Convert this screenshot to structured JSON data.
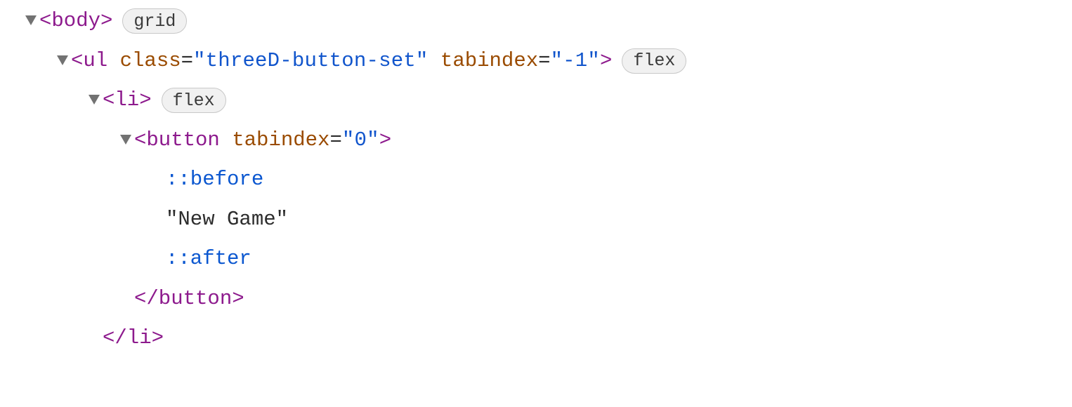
{
  "tree": {
    "body": {
      "tag_open": "<body>",
      "badge": "grid"
    },
    "ul": {
      "tag_name_open": "<ul",
      "attr1_name": "class",
      "attr1_val": "\"threeD-button-set\"",
      "attr2_name": "tabindex",
      "attr2_val": "\"-1\"",
      "tag_close": ">",
      "badge": "flex"
    },
    "li": {
      "tag_open": "<li>",
      "tag_end": "</li>",
      "badge": "flex"
    },
    "button": {
      "tag_name_open": "<button",
      "attr1_name": "tabindex",
      "attr1_val": "\"0\"",
      "tag_close": ">",
      "tag_end": "</button>"
    },
    "pseudo_before": "::before",
    "text_node": "\"New Game\"",
    "pseudo_after": "::after"
  },
  "punct": {
    "eq": "=",
    "space": " "
  }
}
